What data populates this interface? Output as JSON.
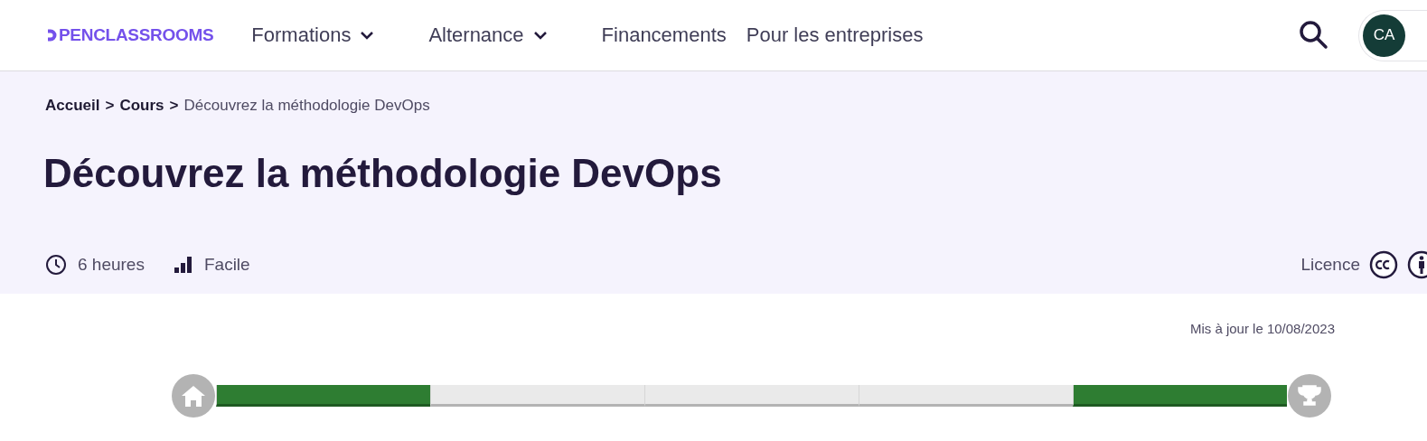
{
  "header": {
    "logo": "PENCLASSROOMS",
    "nav": [
      {
        "label": "Formations",
        "dropdown": true
      },
      {
        "label": "Alternance",
        "dropdown": true
      },
      {
        "label": "Financements",
        "dropdown": false
      },
      {
        "label": "Pour les entreprises",
        "dropdown": false
      }
    ],
    "avatar": "CA"
  },
  "breadcrumb": [
    {
      "label": "Accueil",
      "link": true
    },
    {
      "separator": ">",
      "label": "Cours",
      "link": true
    },
    {
      "separator": ">",
      "label": "Découvrez la méthodologie DevOps",
      "link": false
    }
  ],
  "title": "Découvrez la méthodologie DevOps",
  "meta": {
    "duration": "6 heures",
    "level": "Facile",
    "licence": "Licence"
  },
  "updated": "Mis à jour le 10/08/2023",
  "progress": [
    {
      "done": true
    },
    {
      "done": false
    },
    {
      "done": false
    },
    {
      "done": false
    },
    {
      "done": true
    }
  ]
}
